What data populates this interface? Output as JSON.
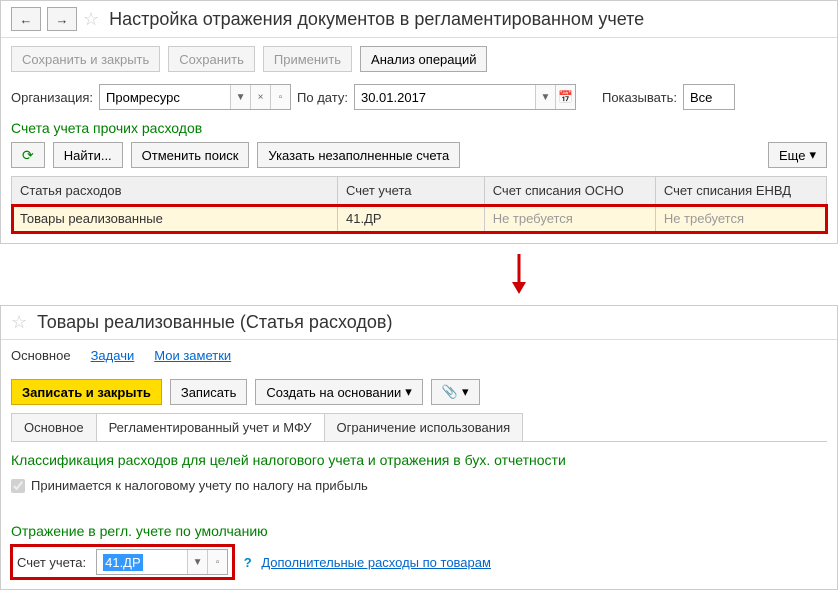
{
  "window1": {
    "title": "Настройка отражения документов в регламентированном учете",
    "toolbar": {
      "save_close": "Сохранить и закрыть",
      "save": "Сохранить",
      "apply": "Применить",
      "analyze": "Анализ операций"
    },
    "filters": {
      "org_label": "Организация:",
      "org_value": "Промресурс",
      "date_label": "По дату:",
      "date_value": "30.01.2017",
      "show_label": "Показывать:",
      "show_value": "Все"
    },
    "section_title": "Счета учета прочих расходов",
    "actions": {
      "find": "Найти...",
      "cancel_search": "Отменить поиск",
      "fill_accounts": "Указать незаполненные счета",
      "more": "Еще"
    },
    "table": {
      "headers": {
        "col1": "Статья расходов",
        "col2": "Счет учета",
        "col3": "Счет списания ОСНО",
        "col4": "Счет списания ЕНВД"
      },
      "row": {
        "c1": "Товары реализованные",
        "c2": "41.ДР",
        "c3": "Не требуется",
        "c4": "Не требуется"
      }
    }
  },
  "window2": {
    "title": "Товары реализованные (Статья расходов)",
    "nav": {
      "main": "Основное",
      "tasks": "Задачи",
      "notes": "Мои заметки"
    },
    "toolbar": {
      "write_close": "Записать и закрыть",
      "write": "Записать",
      "create_based": "Создать на основании"
    },
    "tabs": {
      "t1": "Основное",
      "t2": "Регламентированный учет и МФУ",
      "t3": "Ограничение использования"
    },
    "classification_title": "Классификация расходов для целей налогового учета и отражения в бух. отчетности",
    "checkbox_label": "Принимается к налоговому учету по налогу на прибыль",
    "reflection_title": "Отражение в регл. учете по умолчанию",
    "account_label": "Счет учета:",
    "account_value": "41.ДР",
    "additional_link": "Дополнительные расходы по товарам"
  }
}
